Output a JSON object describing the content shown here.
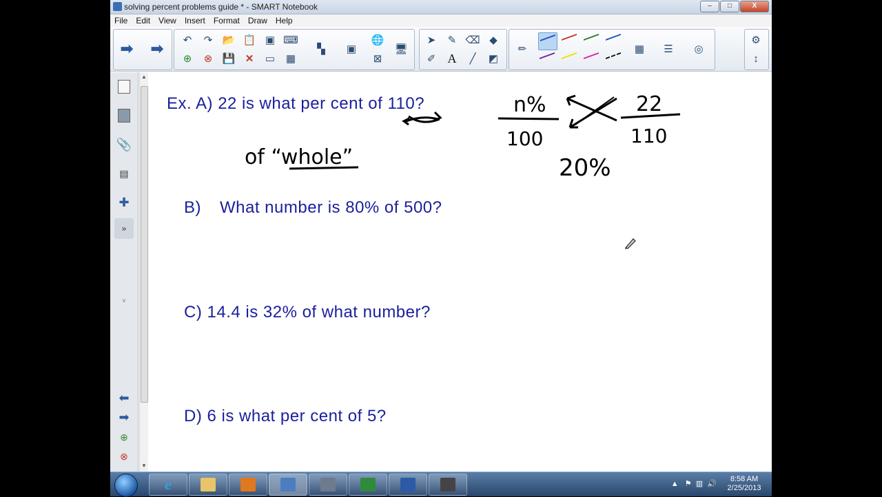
{
  "window": {
    "title": "solving percent problems guide * - SMART Notebook",
    "buttons": {
      "minimize": "–",
      "maximize": "□",
      "close": "X"
    }
  },
  "menu": [
    "File",
    "Edit",
    "View",
    "Insert",
    "Format",
    "Draw",
    "Help"
  ],
  "toolbar": {
    "nav": [
      "back-arrow-icon",
      "forward-arrow-icon"
    ],
    "edit_tools": [
      "undo-icon",
      "redo-icon",
      "open-icon",
      "paste-icon",
      "screen-capture-icon",
      "keyboard-icon",
      "add-page-icon",
      "delete-page-icon",
      "save-icon",
      "delete-icon",
      "screen-shade-icon",
      "table-icon"
    ],
    "tools": [
      "select-icon",
      "magic-pen-icon",
      "eraser-icon",
      "shape-icon",
      "pens-icon",
      "text-icon",
      "line-icon",
      "fill-icon"
    ],
    "pen_colors": [
      "#1f4fbf",
      "#c0392b",
      "#2e7d32",
      "#1f4fbf",
      "#7b1fa2",
      "#f1e000",
      "#e0209f",
      "#111111"
    ],
    "text_tool_label": "A"
  },
  "questions": {
    "a": "Ex. A)  22 is what  per cent  of  110?",
    "b_label": "B)",
    "b_text": "What  number  is 80% of  500?",
    "c": "C)  14.4  is 32% of  what  number?",
    "d": "D)  6  is what  per cent  of  5?"
  },
  "handwriting": {
    "of_whole": "of “whole”",
    "num_left": "n%",
    "den_left": "100",
    "num_right": "22",
    "den_right": "110",
    "answer": "20%"
  },
  "taskbar": {
    "apps": [
      "internet-explorer-icon",
      "file-explorer-icon",
      "media-player-icon",
      "smart-notebook-icon",
      "notebook-tools-icon",
      "excel-icon",
      "word-icon",
      "camera-icon"
    ],
    "time": "8:58 AM",
    "date": "2/25/2013"
  }
}
